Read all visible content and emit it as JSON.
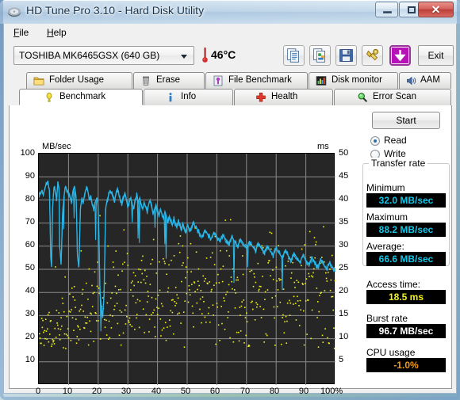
{
  "window": {
    "title": "HD Tune Pro 3.10 - Hard Disk Utility",
    "icon": "hard-disk-icon",
    "minimize_label": "",
    "maximize_label": "",
    "close_label": "✕"
  },
  "menu": {
    "items": [
      {
        "label": "File",
        "mnemonic": "F"
      },
      {
        "label": "Help",
        "mnemonic": "H"
      }
    ]
  },
  "toolbar": {
    "drive": "TOSHIBA MK6465GSX (640 GB)",
    "temperature": "46°C",
    "temperature_raw": "46",
    "thermometer_icon": "thermometer-icon",
    "buttons": [
      {
        "name": "copy-text-icon",
        "tooltip": "Copy text"
      },
      {
        "name": "copy-image-icon",
        "tooltip": "Copy image"
      },
      {
        "name": "save-icon",
        "tooltip": "Save"
      },
      {
        "name": "options-wrench-icon",
        "tooltip": "Options"
      },
      {
        "name": "download-icon",
        "tooltip": "Download"
      }
    ],
    "exit_label": "Exit"
  },
  "tabs": {
    "row1": [
      {
        "label": "Folder Usage",
        "icon": "folder-icon",
        "active": false
      },
      {
        "label": "Erase",
        "icon": "trash-icon",
        "active": false
      },
      {
        "label": "File Benchmark",
        "icon": "file-benchmark-icon",
        "active": false
      },
      {
        "label": "Disk monitor",
        "icon": "bar-chart-icon",
        "active": false
      },
      {
        "label": "AAM",
        "icon": "speaker-icon",
        "active": false
      }
    ],
    "row2": [
      {
        "label": "Benchmark",
        "icon": "bulb-icon",
        "active": true
      },
      {
        "label": "Info",
        "icon": "info-icon",
        "active": false
      },
      {
        "label": "Health",
        "icon": "red-cross-icon",
        "active": false
      },
      {
        "label": "Error Scan",
        "icon": "magnifier-icon",
        "active": false
      }
    ]
  },
  "side_panel": {
    "start_label": "Start",
    "mode_read_label": "Read",
    "mode_write_label": "Write",
    "mode_selected": "Read",
    "transfer_group_label": "Transfer rate",
    "minimum_label": "Minimum",
    "minimum_value": "32.0 MB/sec",
    "maximum_label": "Maximum",
    "maximum_value": "88.2 MB/sec",
    "average_label": "Average:",
    "average_value": "66.6 MB/sec",
    "access_time_label": "Access time:",
    "access_time_value": "18.5 ms",
    "burst_rate_label": "Burst rate",
    "burst_rate_value": "96.7 MB/sec",
    "cpu_usage_label": "CPU usage",
    "cpu_usage_value": "-1.0%"
  },
  "colors": {
    "transfer_curve": "#29b6e8",
    "access_dots": "#f2f21a",
    "lcd_cyan": "#13c6e8",
    "lcd_yellow": "#f2f21a",
    "lcd_orange": "#f09a18",
    "plot_bg": "#262626",
    "grid": "#8a8a8a"
  },
  "chart_data": {
    "type": "line",
    "title": "",
    "xlabel": "",
    "ylabel": "MB/sec",
    "y2label": "ms",
    "xlim": [
      0,
      100
    ],
    "ylim": [
      0,
      100
    ],
    "y2lim": [
      0,
      50
    ],
    "grid": true,
    "legend": "none",
    "x_ticks": [
      "0",
      "10",
      "20",
      "30",
      "40",
      "50",
      "60",
      "70",
      "80",
      "90",
      "100%"
    ],
    "y_ticks": [
      "10",
      "20",
      "30",
      "40",
      "50",
      "60",
      "70",
      "80",
      "90",
      "100"
    ],
    "y2_ticks": [
      "5",
      "10",
      "15",
      "20",
      "25",
      "30",
      "35",
      "40",
      "45",
      "50"
    ],
    "series": [
      {
        "name": "Transfer rate",
        "axis": "left",
        "unit": "MB/sec",
        "color": "#29b6e8",
        "x": [
          0,
          0.5,
          1,
          1.5,
          2,
          2.5,
          3,
          3.3,
          3.6,
          4,
          4.3,
          4.6,
          5,
          5.3,
          5.6,
          6,
          6.4,
          6.8,
          7,
          7.5,
          8,
          8.5,
          9,
          9.5,
          10,
          10.5,
          11,
          11.5,
          12,
          12.3,
          12.6,
          13,
          13.5,
          14,
          14.5,
          15,
          15.5,
          16,
          16.5,
          17,
          17.5,
          18,
          18.5,
          19,
          19.3,
          19.6,
          20,
          20.3,
          20.6,
          21,
          21.5,
          22,
          22.5,
          23,
          23.5,
          24,
          24.5,
          25,
          25.5,
          26,
          26.5,
          27,
          27.5,
          28,
          28.5,
          29,
          29.5,
          30,
          30.5,
          31,
          31.5,
          32,
          32.5,
          33,
          33.5,
          34,
          34.5,
          35,
          35.5,
          36,
          36.5,
          37,
          37.5,
          38,
          38.5,
          39,
          39.5,
          40,
          40.5,
          41,
          41.5,
          42,
          42.5,
          43,
          43.5,
          44,
          44.5,
          45,
          45.5,
          46,
          46.5,
          47,
          47.5,
          48,
          48.5,
          49,
          49.5,
          50,
          51,
          52,
          53,
          54,
          55,
          56,
          57,
          58,
          59,
          60,
          61,
          62,
          63,
          64,
          65,
          66,
          67,
          68,
          69,
          70,
          71,
          72,
          73,
          74,
          75,
          76,
          77,
          78,
          79,
          80,
          81,
          82,
          83,
          84,
          85,
          86,
          87,
          88,
          89,
          90,
          91,
          92,
          93,
          94,
          95,
          96,
          97,
          98,
          99,
          100
        ],
        "values": [
          81,
          83,
          84,
          82,
          85,
          87,
          88,
          86,
          84,
          55,
          51,
          76,
          84,
          86,
          83,
          80,
          88,
          85,
          60,
          52,
          74,
          82,
          86,
          84,
          83,
          81,
          79,
          84,
          86,
          83,
          80,
          56,
          51,
          76,
          81,
          79,
          83,
          85,
          84,
          80,
          82,
          78,
          76,
          79,
          80,
          81,
          77,
          62,
          40,
          35,
          29,
          40,
          76,
          80,
          82,
          84,
          83,
          81,
          79,
          83,
          85,
          82,
          80,
          78,
          81,
          83,
          80,
          77,
          79,
          81,
          78,
          76,
          80,
          82,
          79,
          81,
          78,
          76,
          79,
          77,
          75,
          78,
          80,
          77,
          74,
          76,
          78,
          75,
          73,
          76,
          74,
          72,
          75,
          73,
          70,
          73,
          71,
          69,
          72,
          70,
          68,
          71,
          69,
          67,
          70,
          68,
          66,
          69,
          67,
          70,
          68,
          66,
          64,
          67,
          65,
          63,
          66,
          64,
          62,
          65,
          63,
          61,
          64,
          62,
          60,
          63,
          61,
          59,
          62,
          60,
          58,
          61,
          59,
          57,
          60,
          58,
          56,
          59,
          57,
          55,
          58,
          56,
          54,
          57,
          55,
          53,
          56,
          54,
          52,
          55,
          53,
          51,
          54,
          52,
          50,
          53,
          51,
          49,
          52,
          50,
          48,
          51,
          49,
          47,
          50,
          48,
          46,
          49,
          47,
          45,
          48,
          46,
          44,
          47,
          45,
          43,
          46,
          44,
          43
        ]
      },
      {
        "name": "Access time",
        "axis": "right",
        "unit": "ms",
        "color": "#f2f21a",
        "type": "scatter",
        "range_ms": [
          8,
          37
        ],
        "mean_ms": 18.5,
        "point_count": 520
      }
    ]
  }
}
